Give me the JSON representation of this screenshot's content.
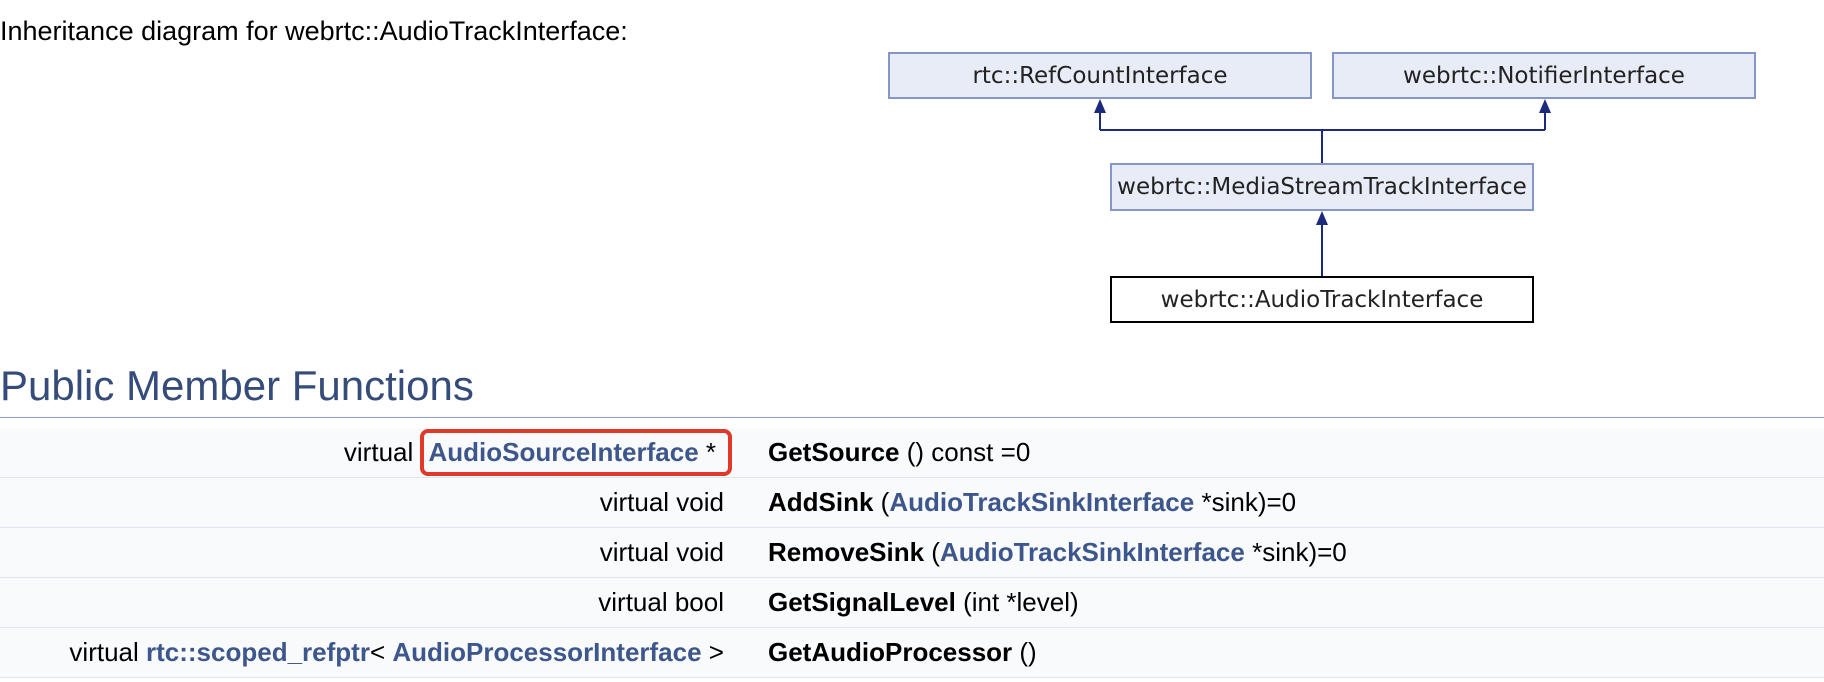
{
  "intro": "Inheritance diagram for webrtc::AudioTrackInterface:",
  "diagram": {
    "nodes": {
      "ref_count": "rtc::RefCountInterface",
      "notifier": "webrtc::NotifierInterface",
      "media_stream_track": "webrtc::MediaStreamTrackInterface",
      "audio_track": "webrtc::AudioTrackInterface"
    }
  },
  "section_title": "Public Member Functions",
  "rows": [
    {
      "left_prefix": "virtual ",
      "left_link": "AudioSourceInterface",
      "left_suffix": " *",
      "fn": "GetSource",
      "args": " () const =0"
    },
    {
      "left_text": "virtual void",
      "fn": "AddSink",
      "args_open": " (",
      "args_link": "AudioTrackSinkInterface",
      "args_close": " *sink)=0"
    },
    {
      "left_text": "virtual void",
      "fn": "RemoveSink",
      "args_open": " (",
      "args_link": "AudioTrackSinkInterface",
      "args_close": " *sink)=0"
    },
    {
      "left_text": "virtual bool",
      "fn": "GetSignalLevel",
      "args": " (int *level)"
    },
    {
      "left_prefix": "virtual ",
      "left_link": "rtc::scoped_refptr",
      "left_mid": "< ",
      "left_link2": "AudioProcessorInterface",
      "left_suffix": " >",
      "fn": "GetAudioProcessor",
      "args": " ()"
    }
  ],
  "colors": {
    "link": "#3d578c",
    "heading": "#354c7b",
    "highlight_box": "#e0382b",
    "node_fill": "#e8ecf7",
    "node_border": "#8497c8"
  }
}
